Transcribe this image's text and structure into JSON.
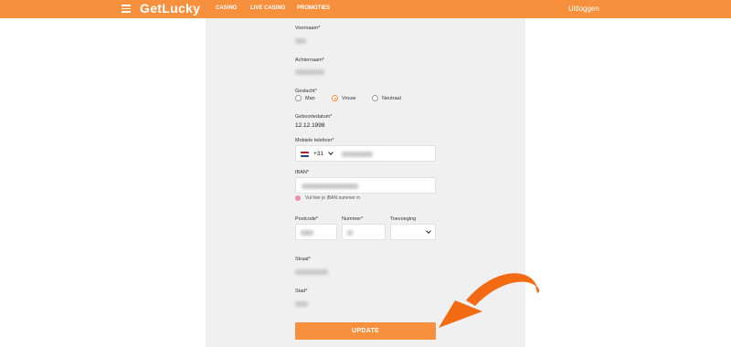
{
  "header": {
    "logo": "GetLucky",
    "nav": [
      "CASINO",
      "LIVE CASINO",
      "PROMOTIES"
    ],
    "logout": "Uitloggen"
  },
  "form": {
    "first_name_label": "Voornaam*",
    "last_name_label": "Achternaam*",
    "gender_label": "Geslacht*",
    "gender_options": [
      "Man",
      "Vrouw",
      "Neutraal"
    ],
    "gender_selected": "Vrouw",
    "dob_label": "Geboortedatum*",
    "dob_value": "12.12.1998",
    "phone_label": "Mobiele telefoon*",
    "phone_code": "+31",
    "iban_label": "IBAN*",
    "iban_hint": "Vul hier je IBAN nummer in",
    "postcode_label": "Postcode*",
    "number_label": "Nummer*",
    "addition_label": "Toevoeging",
    "street_label": "Straat*",
    "city_label": "Stad*",
    "update_label": "UPDATE"
  },
  "colors": {
    "accent": "#f7903c",
    "arrow": "#f26a12"
  }
}
